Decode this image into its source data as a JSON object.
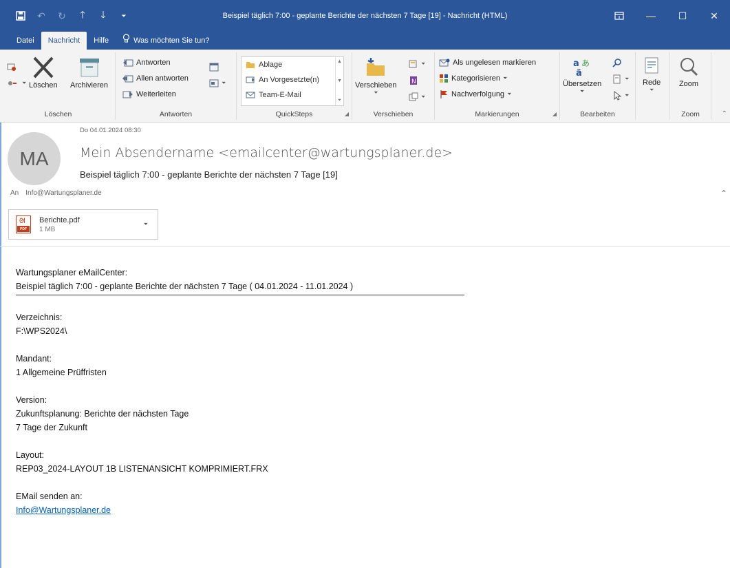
{
  "window": {
    "title": "Beispiel täglich 7:00 - geplante Berichte der nächsten 7 Tage [19]  -  Nachricht (HTML)"
  },
  "ribbon_tabs": [
    {
      "label": "Datei"
    },
    {
      "label": "Nachricht"
    },
    {
      "label": "Hilfe"
    }
  ],
  "tellme": {
    "label": "Was möchten Sie tun?"
  },
  "groups": {
    "loeschen": {
      "label": "Löschen",
      "delete": "Löschen",
      "archive": "Archivieren"
    },
    "antworten": {
      "label": "Antworten",
      "reply": "Antworten",
      "reply_all": "Allen antworten",
      "forward": "Weiterleiten"
    },
    "quicksteps": {
      "label": "QuickSteps",
      "items": [
        "Ablage",
        "An Vorgesetzte(n)",
        "Team-E-Mail"
      ]
    },
    "verschieben": {
      "label": "Verschieben",
      "move": "Verschieben"
    },
    "markierungen": {
      "label": "Markierungen",
      "unread": "Als ungelesen markieren",
      "categorize": "Kategorisieren",
      "followup": "Nachverfolgung"
    },
    "bearbeiten": {
      "label": "Bearbeiten",
      "translate": "Übersetzen"
    },
    "sprechen": {
      "read": "Rede"
    },
    "zoom": {
      "label": "Zoom",
      "zoom": "Zoom"
    }
  },
  "message": {
    "avatar_initials": "MA",
    "date": "Do 04.01.2024 08:30",
    "from": "Mein Absendername <emailcenter@wartungsplaner.de>",
    "subject": "Beispiel täglich 7:00 - geplante Berichte der nächsten 7 Tage [19]",
    "to_label": "An",
    "to": "Info@Wartungsplaner.de"
  },
  "attachment": {
    "name": "Berichte.pdf",
    "size": "1 MB",
    "type_badge": "PDF"
  },
  "body": {
    "intro_line1": "Wartungsplaner eMailCenter:",
    "intro_line2": "Beispiel täglich 7:00 - geplante Berichte der nächsten 7 Tage ( 04.01.2024 - 11.01.2024 )",
    "verzeichnis_label": "Verzeichnis:",
    "verzeichnis_value": "F:\\WPS2024\\",
    "mandant_label": "Mandant:",
    "mandant_value": "1 Allgemeine Prüffristen",
    "version_label": "Version:",
    "version_line1": "Zukunftsplanung: Berichte der nächsten Tage",
    "version_line2": "7 Tage der Zukunft",
    "layout_label": "Layout:",
    "layout_value": "REP03_2024-LAYOUT 1B LISTENANSICHT KOMPRIMIERT.FRX",
    "send_label": "EMail senden an:",
    "send_value": "Info@Wartungsplaner.de"
  },
  "colors": {
    "titlebar": "#2b579a",
    "ribbon": "#f3f3f3",
    "link": "#0563c1",
    "pdf": "#c43e1c"
  }
}
